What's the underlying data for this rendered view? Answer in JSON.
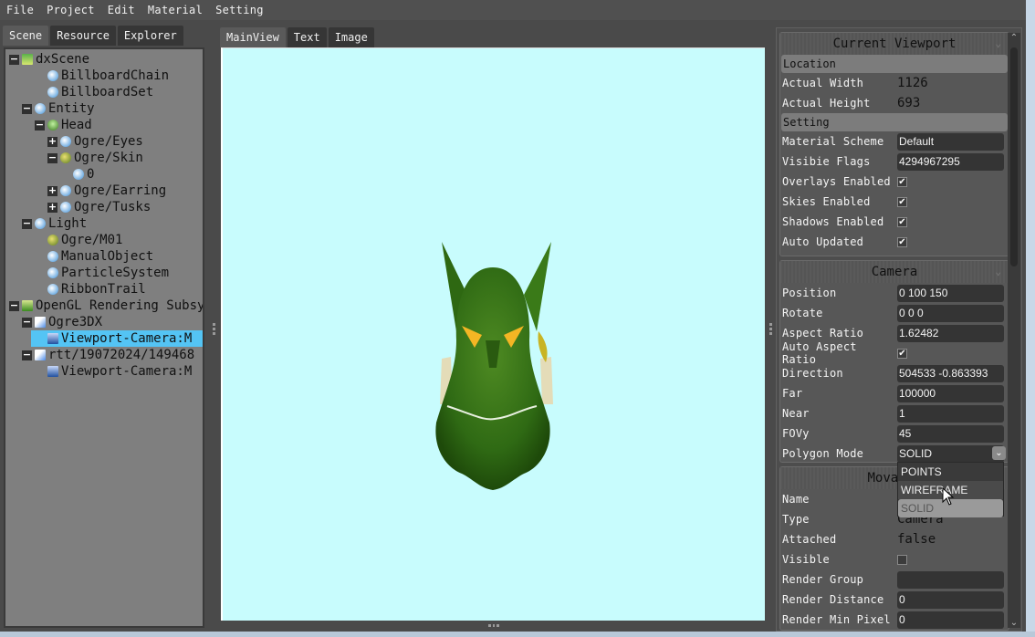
{
  "menubar": {
    "items": [
      "File",
      "Project",
      "Edit",
      "Material",
      "Setting"
    ]
  },
  "left_panel": {
    "tabs": [
      {
        "label": "Scene",
        "active": true
      },
      {
        "label": "Resource",
        "active": false
      },
      {
        "label": "Explorer",
        "active": false
      }
    ],
    "tree": [
      {
        "label": "dxScene",
        "expander": "−",
        "icon": "scene-icon"
      },
      {
        "label": "BillboardChain",
        "expander": "",
        "icon": "object-icon"
      },
      {
        "label": "BillboardSet",
        "expander": "",
        "icon": "object-icon"
      },
      {
        "label": "Entity",
        "expander": "−",
        "icon": "object-icon"
      },
      {
        "label": "Head",
        "expander": "−",
        "icon": "mesh-icon"
      },
      {
        "label": "Ogre/Eyes",
        "expander": "+",
        "icon": "object-icon"
      },
      {
        "label": "Ogre/Skin",
        "expander": "−",
        "icon": "material-icon"
      },
      {
        "label": "0",
        "expander": "",
        "icon": "object-icon"
      },
      {
        "label": "Ogre/Earring",
        "expander": "+",
        "icon": "object-icon"
      },
      {
        "label": "Ogre/Tusks",
        "expander": "+",
        "icon": "object-icon"
      },
      {
        "label": "Light",
        "expander": "−",
        "icon": "object-icon"
      },
      {
        "label": "Ogre/M01",
        "expander": "",
        "icon": "material-icon"
      },
      {
        "label": "ManualObject",
        "expander": "",
        "icon": "object-icon"
      },
      {
        "label": "ParticleSystem",
        "expander": "",
        "icon": "object-icon"
      },
      {
        "label": "RibbonTrail",
        "expander": "",
        "icon": "object-icon"
      },
      {
        "label": "OpenGL Rendering Subsystem",
        "expander": "−",
        "icon": "render-system-icon"
      },
      {
        "label": "Ogre3DX",
        "expander": "−",
        "icon": "render-target-icon"
      },
      {
        "label": "Viewport-Camera:M",
        "expander": "",
        "icon": "viewport-icon",
        "selected": true
      },
      {
        "label": "rtt/19072024/149468",
        "expander": "−",
        "icon": "render-target-icon"
      },
      {
        "label": "Viewport-Camera:M",
        "expander": "",
        "icon": "viewport-icon"
      }
    ]
  },
  "center": {
    "tabs": [
      {
        "label": "MainView",
        "active": true
      },
      {
        "label": "Text",
        "active": false
      },
      {
        "label": "Image",
        "active": false
      }
    ],
    "viewport_background": "#c8fcfd"
  },
  "right_panel": {
    "current_viewport": {
      "title": "Current Viewport",
      "location_section": "Location",
      "actual_width_label": "Actual Width",
      "actual_width": "1126",
      "actual_height_label": "Actual Height",
      "actual_height": "693",
      "setting_section": "Setting",
      "material_scheme_label": "Material Scheme",
      "material_scheme": "Default",
      "visible_flags_label": "Visibie Flags",
      "visible_flags": "4294967295",
      "overlays_enabled_label": "Overlays Enabled",
      "overlays_enabled": true,
      "skies_enabled_label": "Skies Enabled",
      "skies_enabled": true,
      "shadows_enabled_label": "Shadows Enabled",
      "shadows_enabled": true,
      "auto_updated_label": "Auto Updated",
      "auto_updated": true
    },
    "camera": {
      "title": "Camera",
      "position_label": "Position",
      "position": "0 100 150",
      "rotate_label": "Rotate",
      "rotate": "0 0 0",
      "aspect_ratio_label": "Aspect Ratio",
      "aspect_ratio": "1.62482",
      "auto_aspect_label": "Auto Aspect Ratio",
      "auto_aspect": true,
      "direction_label": "Direction",
      "direction": "504533 -0.863393",
      "far_label": "Far",
      "far": "100000",
      "near_label": "Near",
      "near": "1",
      "fovy_label": "FOVy",
      "fovy": "45",
      "polygon_mode_label": "Polygon Mode",
      "polygon_mode": "SOLID",
      "polygon_mode_options": [
        "POINTS",
        "WIREFRAME",
        "SOLID"
      ],
      "hovered_option": "WIREFRAME"
    },
    "movable": {
      "title": "Movable",
      "name_label": "Name",
      "name": "",
      "type_label": "Type",
      "type": "Camera",
      "attached_label": "Attached",
      "attached": "false",
      "visible_label": "Visible",
      "visible": false,
      "render_group_label": "Render Group",
      "render_group": "",
      "render_distance_label": "Render Distance",
      "render_distance": "0",
      "render_min_pixel_label": "Render Min Pixel",
      "render_min_pixel": "0"
    }
  }
}
